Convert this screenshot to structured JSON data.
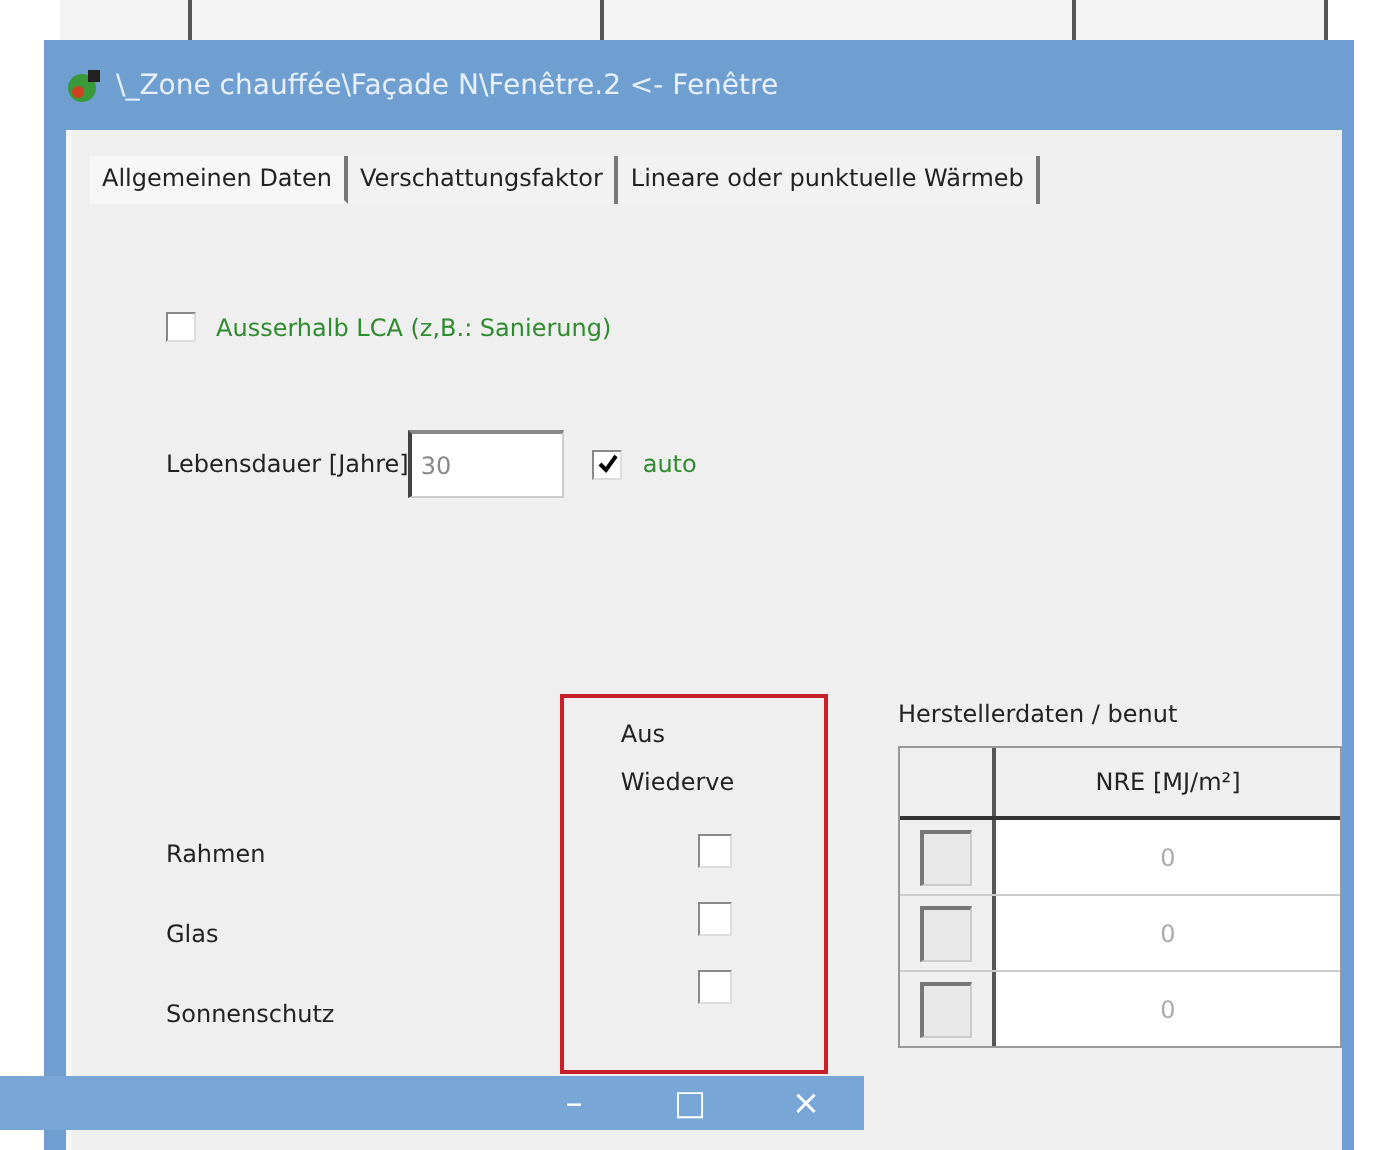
{
  "window": {
    "title": "\\_Zone chauffée\\Façade N\\Fenêtre.2 <- Fenêtre"
  },
  "tabs": [
    {
      "label": "Allgemeinen Daten",
      "selected": true
    },
    {
      "label": "Verschattungsfaktor",
      "selected": false
    },
    {
      "label": "Lineare oder punktuelle Wärmeb",
      "selected": false
    }
  ],
  "outside_lca": {
    "label": "Ausserhalb LCA (z,B.: Sanierung)",
    "checked": false
  },
  "lifetime": {
    "label": "Lebensdauer [Jahre]",
    "value": "30",
    "auto_label": "auto",
    "auto_checked": true
  },
  "reuse_column": {
    "header_line_1": "Aus",
    "header_line_2": "Wiederve"
  },
  "components": [
    {
      "name": "Rahmen",
      "checked": false
    },
    {
      "name": "Glas",
      "checked": false
    },
    {
      "name": "Sonnenschutz",
      "checked": false
    }
  ],
  "manufacturer": {
    "title": "Herstellerdaten / benut",
    "columns": [
      "NRE [MJ/m²]"
    ],
    "rows": [
      {
        "checked": false,
        "value": "0"
      },
      {
        "checked": false,
        "value": "0"
      },
      {
        "checked": false,
        "value": "0"
      }
    ]
  },
  "overlay_window": {
    "buttons": [
      "–",
      "□",
      "×"
    ]
  }
}
